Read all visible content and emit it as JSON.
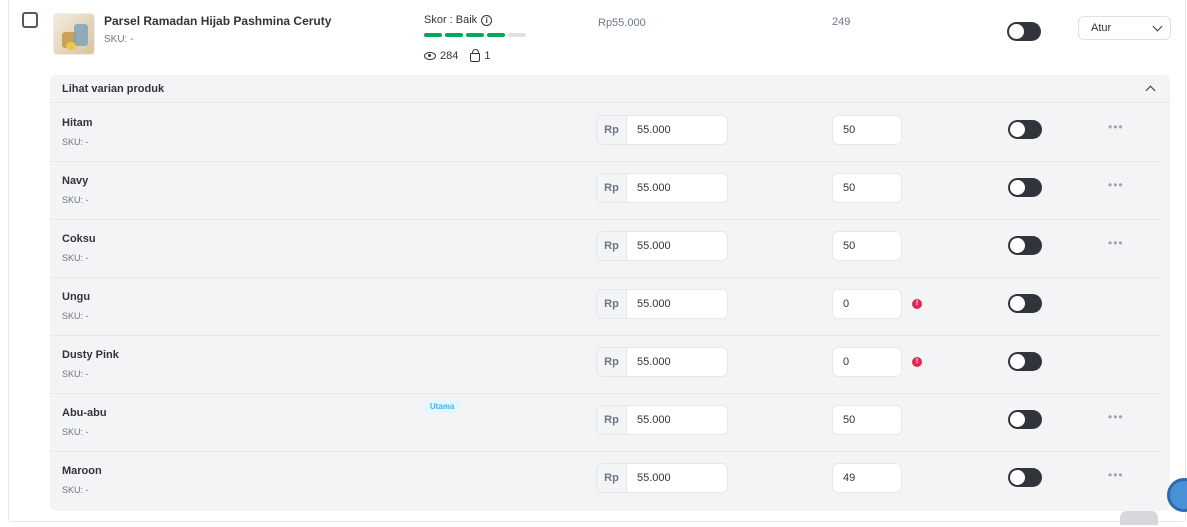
{
  "product": {
    "name": "Parsel Ramadan Hijab Pashmina Ceruty",
    "sku": "SKU: -",
    "score_label": "Skor : Baik",
    "score_segments_filled": 4,
    "score_segments_total": 5,
    "views": "284",
    "wishlist": "1",
    "price": "Rp55.000",
    "stock": "249",
    "action_label": "Atur"
  },
  "variants_panel": {
    "title": "Lihat varian produk",
    "currency": "Rp",
    "rows": [
      {
        "name": "Hitam",
        "sku": "SKU: -",
        "price": "55.000",
        "stock": "50",
        "warning": false,
        "badge": ""
      },
      {
        "name": "Navy",
        "sku": "SKU: -",
        "price": "55.000",
        "stock": "50",
        "warning": false,
        "badge": ""
      },
      {
        "name": "Coksu",
        "sku": "SKU: -",
        "price": "55.000",
        "stock": "50",
        "warning": false,
        "badge": ""
      },
      {
        "name": "Ungu",
        "sku": "SKU: -",
        "price": "55.000",
        "stock": "0",
        "warning": true,
        "badge": ""
      },
      {
        "name": "Dusty Pink",
        "sku": "SKU: -",
        "price": "55.000",
        "stock": "0",
        "warning": true,
        "badge": ""
      },
      {
        "name": "Abu-abu",
        "sku": "SKU: -",
        "price": "55.000",
        "stock": "50",
        "warning": false,
        "badge": "Utama"
      },
      {
        "name": "Maroon",
        "sku": "SKU: -",
        "price": "55.000",
        "stock": "49",
        "warning": false,
        "badge": ""
      }
    ],
    "more_label": "•••",
    "warn_glyph": "!"
  },
  "colors": {
    "score_green": "#00aa5b",
    "toggle_dark": "#31353b",
    "warning_red": "#e02954",
    "badge_blue": "#3fb3f1"
  }
}
